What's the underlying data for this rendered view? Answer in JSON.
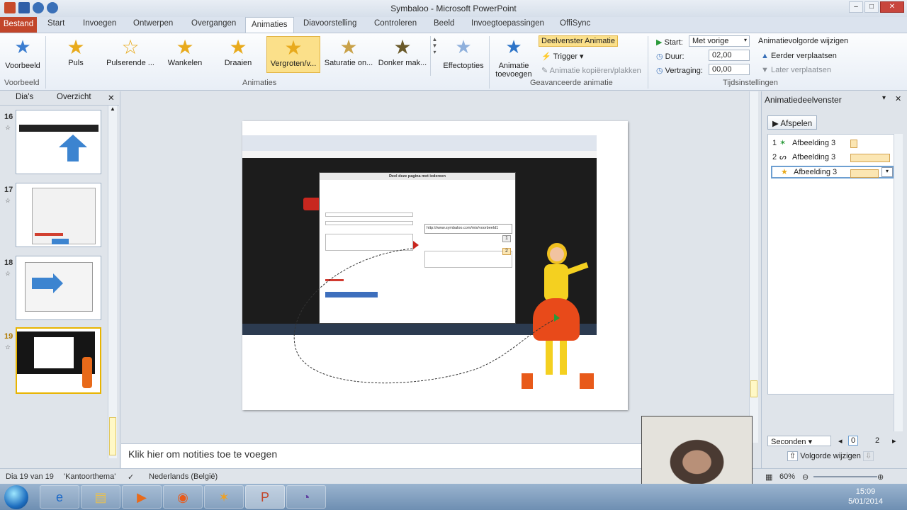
{
  "window": {
    "title": "Symbaloo - Microsoft PowerPoint"
  },
  "tabs": [
    "Bestand",
    "Start",
    "Invoegen",
    "Ontwerpen",
    "Overgangen",
    "Animaties",
    "Diavoorstelling",
    "Controleren",
    "Beeld",
    "Invoegtoepassingen",
    "OffiSync"
  ],
  "ribbon": {
    "preview": {
      "label": "Voorbeeld",
      "group": "Voorbeeld"
    },
    "animations": {
      "group": "Animaties",
      "items": [
        "Puls",
        "Pulserende ...",
        "Wankelen",
        "Draaien",
        "Vergroten/v...",
        "Saturatie on...",
        "Donker mak..."
      ],
      "selected_index": 4,
      "effect_options": "Effectopties"
    },
    "advanced": {
      "group": "Geavanceerde animatie",
      "add_animation": "Animatie toevoegen",
      "pane": "Deelvenster Animatie",
      "trigger": "Trigger",
      "painter": "Animatie kopiëren/plakken"
    },
    "timing": {
      "group": "Tijdsinstellingen",
      "start_label": "Start:",
      "start_value": "Met vorige",
      "duration_label": "Duur:",
      "duration_value": "02,00",
      "delay_label": "Vertraging:",
      "delay_value": "00,00",
      "reorder_title": "Animatievolgorde wijzigen",
      "move_earlier": "Eerder verplaatsen",
      "move_later": "Later verplaatsen"
    }
  },
  "left_panel": {
    "tab_slides": "Dia's",
    "tab_outline": "Overzicht",
    "slides": [
      "16",
      "17",
      "18",
      "19"
    ],
    "selected_slide": "19"
  },
  "slide": {
    "dialog_title": "Deel deze pagina met iedereen",
    "url": "http://www.symbaloo.com/mix/voorbeeld1",
    "tag1": "1",
    "tag2": "2"
  },
  "notes_placeholder": "Klik hier om notities toe te voegen",
  "anim_pane": {
    "title": "Animatiedeelvenster",
    "play": "Afspelen",
    "items": [
      {
        "num": "1",
        "label": "Afbeelding 3"
      },
      {
        "num": "2",
        "label": "Afbeelding 3"
      },
      {
        "num": "",
        "label": "Afbeelding 3"
      }
    ],
    "seconds": "Seconden",
    "tick0": "0",
    "tick2": "2",
    "reorder": "Volgorde wijzigen"
  },
  "status": {
    "slide_of": "Dia 19 van 19",
    "theme": "'Kantoorthema'",
    "language": "Nederlands (België)",
    "zoom": "60%"
  },
  "taskbar": {
    "time": "15:09",
    "date": "5/01/2014"
  },
  "colors": {
    "file_tab": "#c2462a",
    "selection": "#fbe08a",
    "anim_bar": "#fbe6b3"
  }
}
